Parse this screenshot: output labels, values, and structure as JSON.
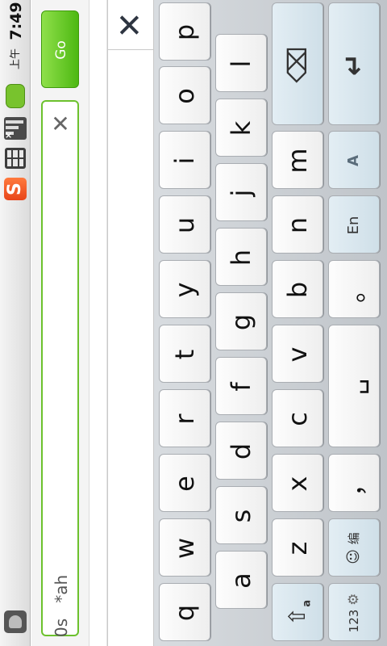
{
  "status_bar": {
    "time": "7:49",
    "ampm": "上午",
    "sogou_letter": "S"
  },
  "input": {
    "go_label": "Go",
    "clear_glyph": "✕",
    "value": "*ah",
    "cursor_text": "0s"
  },
  "candidates": {
    "close_glyph": "✕"
  },
  "keyboard": {
    "row1": [
      "q",
      "w",
      "e",
      "r",
      "t",
      "y",
      "u",
      "i",
      "o",
      "p"
    ],
    "row2": [
      "a",
      "s",
      "d",
      "f",
      "g",
      "h",
      "j",
      "k",
      "l"
    ],
    "row3": [
      "z",
      "x",
      "c",
      "v",
      "b",
      "n",
      "m"
    ],
    "backspace_glyph": "⌫",
    "shift_label": "a",
    "emoji_label": "编",
    "comma": "，",
    "space_glyph": "␣",
    "period": "。",
    "lang_label": "En",
    "mode_label": "A",
    "enter_glyph": "↵",
    "num_label": "123",
    "gear_glyph": "⚙"
  },
  "colors": {
    "go_green": "#4db812",
    "field_border": "#6cc12d",
    "function_key": "#d4e4ec"
  }
}
